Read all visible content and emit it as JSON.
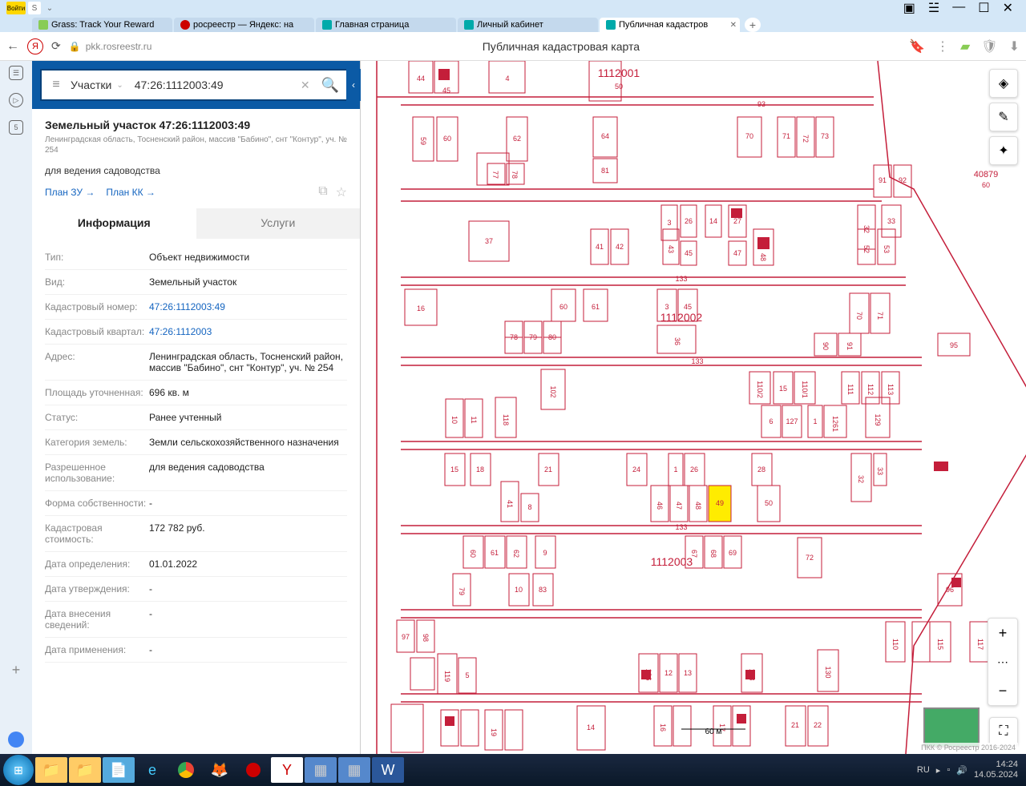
{
  "browser": {
    "avatar_label": "Войти",
    "tabs": [
      {
        "label": "Grass: Track Your Reward"
      },
      {
        "label": "росреестр — Яндекс: на"
      },
      {
        "label": "Главная страница"
      },
      {
        "label": "Личный кабинет"
      },
      {
        "label": "Публичная кадастров"
      }
    ],
    "url": "pkk.rosreestr.ru",
    "page_title": "Публичная кадастровая карта"
  },
  "search": {
    "type": "Участки",
    "value": "47:26:1112003:49"
  },
  "panel": {
    "title": "Земельный участок 47:26:1112003:49",
    "subtitle": "Ленинградская область, Тосненский район, массив \"Бабино\", снт \"Контур\", уч. № 254",
    "usage": "для ведения садоводства",
    "plan_links": {
      "zu": "План ЗУ →",
      "kk": "План КК →"
    },
    "tabs": {
      "info": "Информация",
      "services": "Услуги"
    },
    "rows": [
      {
        "label": "Тип:",
        "value": "Объект недвижимости"
      },
      {
        "label": "Вид:",
        "value": "Земельный участок"
      },
      {
        "label": "Кадастровый номер:",
        "value": "47:26:1112003:49",
        "link": true
      },
      {
        "label": "Кадастровый квартал:",
        "value": "47:26:1112003",
        "link": true
      },
      {
        "label": "Адрес:",
        "value": "Ленинградская область, Тосненский район, массив \"Бабино\", снт \"Контур\", уч. № 254"
      },
      {
        "label": "Площадь уточненная:",
        "value": "696 кв. м"
      },
      {
        "label": "Статус:",
        "value": "Ранее учтенный"
      },
      {
        "label": "Категория земель:",
        "value": "Земли сельскохозяйственного назначения"
      },
      {
        "label": "Разрешенное использование:",
        "value": "для ведения садоводства"
      },
      {
        "label": "Форма собственности:",
        "value": "-"
      },
      {
        "label": "Кадастровая стоимость:",
        "value": "172 782 руб."
      },
      {
        "label": "Дата определения:",
        "value": "01.01.2022"
      },
      {
        "label": "Дата утверждения:",
        "value": "-"
      },
      {
        "label": "Дата внесения сведений:",
        "value": "-"
      },
      {
        "label": "Дата применения:",
        "value": "-"
      }
    ]
  },
  "map": {
    "blocks": [
      "1112001",
      "1112002",
      "1112003"
    ],
    "streets_label": "133",
    "east_label": "40879",
    "scale": "60 м",
    "attribution": "ПКК © Росреестр 2016-2024"
  },
  "taskbar": {
    "lang": "RU",
    "time": "14:24",
    "date": "14.05.2024"
  }
}
